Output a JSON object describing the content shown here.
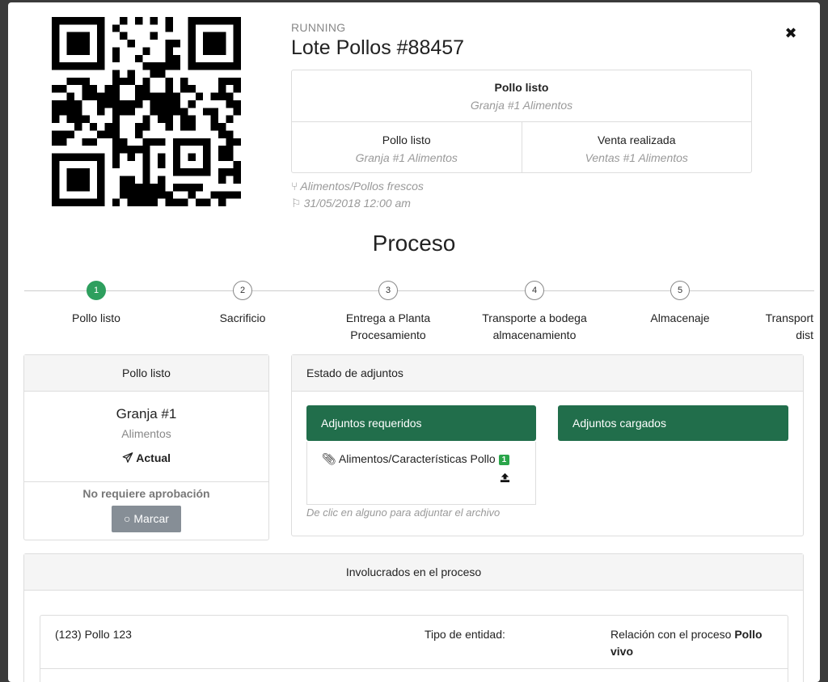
{
  "modal": {
    "close_label": "✖"
  },
  "header": {
    "status": "RUNNING",
    "title": "Lote Pollos #88457",
    "summary": {
      "top": {
        "title": "Pollo listo",
        "subtitle": "Granja #1 Alimentos"
      },
      "left": {
        "title": "Pollo listo",
        "subtitle": "Granja #1 Alimentos"
      },
      "right": {
        "title": "Venta realizada",
        "subtitle": "Ventas #1 Alimentos"
      }
    },
    "category": "Alimentos/Pollos frescos",
    "date": "31/05/2018 12:00 am"
  },
  "proceso": {
    "title": "Proceso",
    "steps": [
      {
        "num": "1",
        "label": "Pollo listo",
        "active": true
      },
      {
        "num": "2",
        "label": "Sacrificio",
        "active": false
      },
      {
        "num": "3",
        "label": "Entrega a Planta Procesamiento",
        "active": false
      },
      {
        "num": "4",
        "label": "Transporte a bodega almacenamiento",
        "active": false
      },
      {
        "num": "5",
        "label": "Almacenaje",
        "active": false
      },
      {
        "num": "",
        "label": "Transport dist",
        "active": false
      }
    ]
  },
  "current_panel": {
    "header": "Pollo listo",
    "entity_name": "Granja #1",
    "entity_dept": "Alimentos",
    "current_label": "Actual",
    "approval_text": "No requiere aprobación",
    "mark_button": "Marcar"
  },
  "attachments_panel": {
    "header": "Estado de adjuntos",
    "required_label": "Adjuntos requeridos",
    "uploaded_label": "Adjuntos cargados",
    "required_items": [
      {
        "name": "Alimentos/Características Pollo",
        "count": "1"
      }
    ],
    "hint": "De clic en alguno para adjuntar el archivo"
  },
  "involved_panel": {
    "header": "Involucrados en el proceso",
    "rows": [
      {
        "entity": "(123) Pollo 123",
        "entity_type_label": "Tipo de entidad:",
        "relation_label": "Relación con el proceso",
        "relation_value": "Pollo vivo"
      }
    ]
  },
  "colors": {
    "accent_green": "#216e4b",
    "step_active": "#2e9f5e",
    "badge_green": "#2aa54a",
    "muted_button": "#868e96"
  },
  "icons": [
    "qr-code-icon",
    "close-icon",
    "branch-icon",
    "flag-icon",
    "paper-plane-icon",
    "circle-icon",
    "paperclip-icon",
    "upload-icon"
  ]
}
